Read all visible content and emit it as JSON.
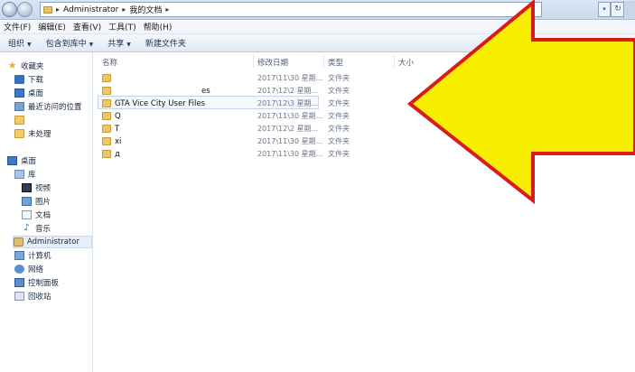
{
  "address_bar": {
    "segments": [
      "Administrator",
      "我的文档"
    ]
  },
  "menubar": {
    "items": [
      "文件(F)",
      "编辑(E)",
      "查看(V)",
      "工具(T)",
      "帮助(H)"
    ]
  },
  "toolbar": {
    "organize": "组织",
    "include_in_library": "包含到库中",
    "share": "共享",
    "new_folder": "新建文件夹"
  },
  "navpane": {
    "favorites": "收藏夹",
    "downloads": "下载",
    "desktop_fav": "桌面",
    "recent": "最近访问的位置",
    "unprocessed": "未处理",
    "desktop": "桌面",
    "libraries": "库",
    "videos": "视频",
    "pictures": "图片",
    "documents": "文档",
    "music": "音乐",
    "administrator": "Administrator",
    "computer": "计算机",
    "network": "网络",
    "control_panel": "控制面板",
    "recycle_bin": "回收站"
  },
  "columns": {
    "name": "名称",
    "date": "修改日期",
    "type": "类型",
    "size": "大小"
  },
  "files": [
    {
      "name": "",
      "date": "2017\\11\\30 星期...",
      "type": "文件夹"
    },
    {
      "name": "es",
      "date": "2017\\12\\2 星期...",
      "type": "文件夹"
    },
    {
      "name": "GTA Vice City User Files",
      "date": "2017\\12\\3 星期...",
      "type": "文件夹"
    },
    {
      "name": "Q",
      "date": "2017\\11\\30 星期...",
      "type": "文件夹"
    },
    {
      "name": "T",
      "date": "2017\\12\\2 星期...",
      "type": "文件夹"
    },
    {
      "name": "xi",
      "date": "2017\\11\\30 星期...",
      "type": "文件夹"
    },
    {
      "name": "д",
      "date": "2017\\11\\30 星期...",
      "type": "文件夹"
    }
  ],
  "colors": {
    "arrow_fill": "#f7ee00",
    "arrow_stroke": "#d81b1b",
    "selection": "#c5d5ea"
  }
}
